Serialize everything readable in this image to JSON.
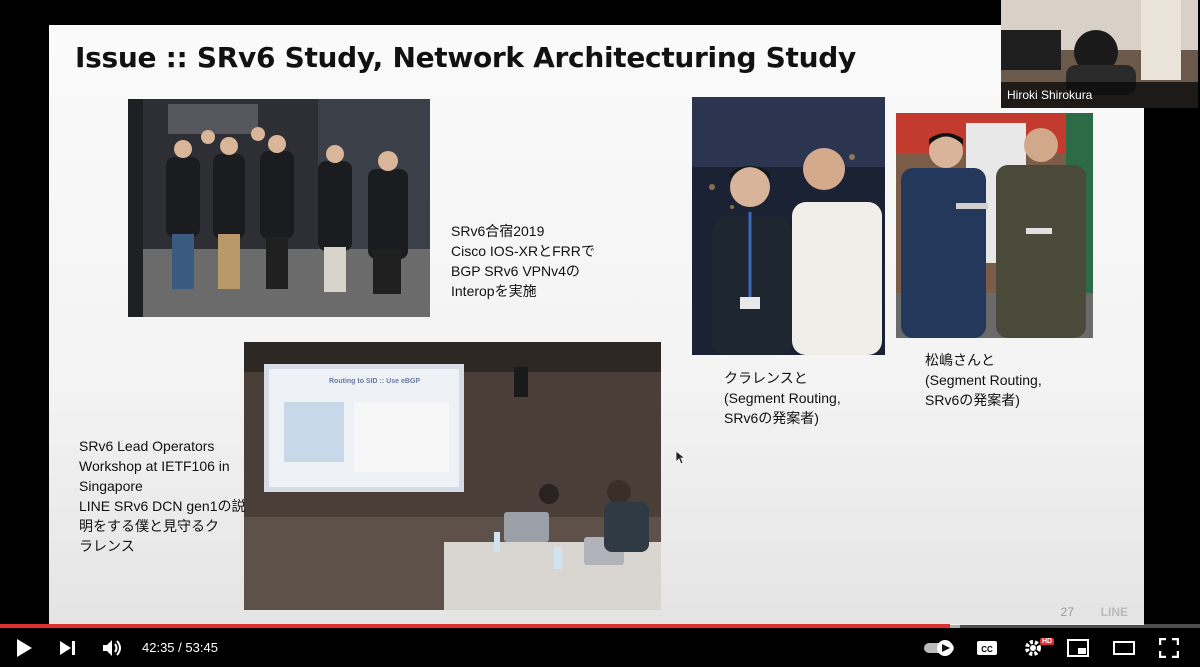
{
  "slide": {
    "title": "Issue :: SRv6 Study, Network Architecturing Study",
    "captions": {
      "retreat": [
        "SRv6合宿2019",
        "Cisco IOS-XRとFRRで",
        "BGP SRv6 VPNv4の",
        "Interopを実施"
      ],
      "ietf": [
        "SRv6 Lead Operators",
        "Workshop at IETF106 in",
        "Singapore",
        "LINE SRv6 DCN gen1の説",
        "明をする僕と見守るク",
        "ラレンス"
      ],
      "clarence": [
        "クラレンスと",
        "(Segment Routing,",
        "SRv6の発案者)"
      ],
      "matsushima": [
        "松嶋さんと",
        "(Segment Routing,",
        "SRv6の発案者)"
      ]
    },
    "embedded_slide_title": "Routing to SID :: Use eBGP",
    "page_number": "27",
    "brand": "LINE"
  },
  "webcam": {
    "name": "Hiroki Shirokura"
  },
  "player": {
    "current_time": "42:35",
    "separator": " / ",
    "duration": "53:45",
    "progress_fraction": 0.792,
    "buffer_fraction": 0.8,
    "hd_badge": "HD",
    "icons": [
      "play-icon",
      "next-icon",
      "volume-icon",
      "autoplay-toggle",
      "captions-icon",
      "settings-icon",
      "miniplayer-icon",
      "theater-icon",
      "fullscreen-icon"
    ],
    "colors": {
      "progress": "#e02f2f",
      "chrome": "#ffffff"
    }
  }
}
